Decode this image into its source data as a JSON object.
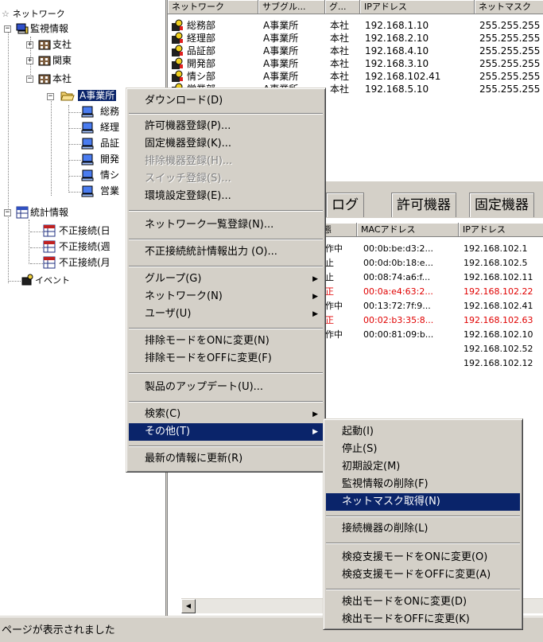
{
  "tree": {
    "root": "ネットワーク",
    "monitor": "監視情報",
    "branch1": "支社",
    "branch2": "関東",
    "hq": "本社",
    "office_a": "A事業所",
    "sub_items": [
      "総務",
      "経理",
      "品証",
      "開発",
      "情シ",
      "営業"
    ],
    "stats": "統計情報",
    "stats_items": [
      "不正接続(日",
      "不正接続(週",
      "不正接続(月"
    ],
    "events": "イベント"
  },
  "upper_table": {
    "headers": [
      "ネットワーク",
      "サブグル...",
      "グ...",
      "IPアドレス",
      "ネットマスク"
    ],
    "rows": [
      [
        "総務部",
        "A事業所",
        "本社",
        "192.168.1.10",
        "255.255.255"
      ],
      [
        "経理部",
        "A事業所",
        "本社",
        "192.168.2.10",
        "255.255.255"
      ],
      [
        "品証部",
        "A事業所",
        "本社",
        "192.168.4.10",
        "255.255.255"
      ],
      [
        "開発部",
        "A事業所",
        "本社",
        "192.168.3.10",
        "255.255.255"
      ],
      [
        "情シ部",
        "A事業所",
        "本社",
        "192.168.102.41",
        "255.255.255"
      ],
      [
        "営業部",
        "A事業所",
        "本社",
        "192.168.5.10",
        "255.255.255"
      ]
    ]
  },
  "tabs": [
    "ログ",
    "許可機器",
    "固定機器"
  ],
  "lower_table": {
    "headers": [
      "態",
      "MACアドレス",
      "IPアドレス"
    ],
    "rows": [
      {
        "status": "作中",
        "mac": "00:0b:be:d3:2...",
        "ip": "192.168.102.1",
        "alert": false
      },
      {
        "status": "止",
        "mac": "00:0d:0b:18:e...",
        "ip": "192.168.102.5",
        "alert": false
      },
      {
        "status": "止",
        "mac": "00:08:74:a6:f...",
        "ip": "192.168.102.11",
        "alert": false
      },
      {
        "status": "正",
        "mac": "00:0a:e4:63:2...",
        "ip": "192.168.102.22",
        "alert": true
      },
      {
        "status": "作中",
        "mac": "00:13:72:7f:9...",
        "ip": "192.168.102.41",
        "alert": false
      },
      {
        "status": "正",
        "mac": "00:02:b3:35:8...",
        "ip": "192.168.102.63",
        "alert": true
      },
      {
        "status": "作中",
        "mac": "00:00:81:09:b...",
        "ip": "192.168.102.10",
        "alert": false
      },
      {
        "status": "",
        "mac": "",
        "ip": "192.168.102.52",
        "alert": false
      },
      {
        "status": "",
        "mac": "",
        "ip": "192.168.102.12",
        "alert": false
      }
    ]
  },
  "context_menu": {
    "download": "ダウンロード(D)",
    "permit_register": "許可機器登録(P)...",
    "fixed_register": "固定機器登録(K)...",
    "exclude_register": "排除機器登録(H)...",
    "switch_register": "スイッチ登録(S)...",
    "env_register": "環境設定登録(E)...",
    "network_list": "ネットワーク一覧登録(N)...",
    "stats_output": "不正接続統計情報出力 (O)...",
    "group": "グループ(G)",
    "network": "ネットワーク(N)",
    "user": "ユーザ(U)",
    "exclude_on": "排除モードをONに変更(N)",
    "exclude_off": "排除モードをOFFに変更(F)",
    "update": "製品のアップデート(U)...",
    "search": "検索(C)",
    "other": "その他(T)",
    "refresh": "最新の情報に更新(R)"
  },
  "submenu": {
    "start": "起動(I)",
    "stop": "停止(S)",
    "init": "初期設定(M)",
    "delete_monitor": "監視情報の削除(F)",
    "get_netmask": "ネットマスク取得(N)",
    "delete_devices": "接続機器の削除(L)",
    "quarantine_on": "検疫支援モードをONに変更(O)",
    "quarantine_off": "検疫支援モードをOFFに変更(A)",
    "detect_on": "検出モードをONに変更(D)",
    "detect_off": "検出モードをOFFに変更(K)"
  },
  "status_bar": "ページが表示されました",
  "colors": {
    "selection": "#0a246a",
    "alert": "#e00000",
    "face": "#d4d0c8"
  }
}
